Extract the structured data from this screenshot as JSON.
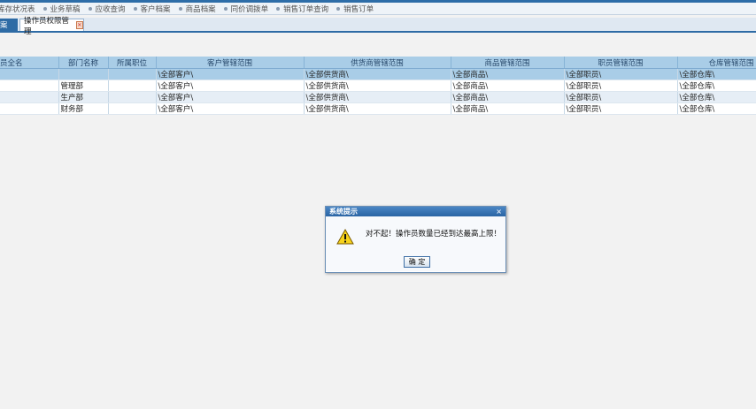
{
  "quicklinks": [
    "库存状况表",
    "业务草稿",
    "应收查询",
    "客户档案",
    "商品档案",
    "同价调拨单",
    "销售订单查询",
    "销售订单"
  ],
  "tabs": {
    "inactive_label": "案",
    "active_label": "操作员权限管理"
  },
  "grid": {
    "headers": [
      "员全名",
      "部门名称",
      "所属职位",
      "客户管辖范围",
      "供货商管辖范围",
      "商品管辖范围",
      "职员管辖范围",
      "仓库管辖范围"
    ],
    "rows": [
      [
        "",
        "",
        "",
        "\\全部客户\\",
        "\\全部供货商\\",
        "\\全部商品\\",
        "\\全部职员\\",
        "\\全部仓库\\"
      ],
      [
        "",
        "管理部",
        "",
        "\\全部客户\\",
        "\\全部供货商\\",
        "\\全部商品\\",
        "\\全部职员\\",
        "\\全部仓库\\"
      ],
      [
        "",
        "生产部",
        "",
        "\\全部客户\\",
        "\\全部供货商\\",
        "\\全部商品\\",
        "\\全部职员\\",
        "\\全部仓库\\"
      ],
      [
        "",
        "财务部",
        "",
        "\\全部客户\\",
        "\\全部供货商\\",
        "\\全部商品\\",
        "\\全部职员\\",
        "\\全部仓库\\"
      ]
    ]
  },
  "dialog": {
    "title": "系统提示",
    "close": "×",
    "message": "对不起！操作员数量已经到达最高上限！",
    "ok_label": "确 定",
    "icon": "warning-icon"
  }
}
